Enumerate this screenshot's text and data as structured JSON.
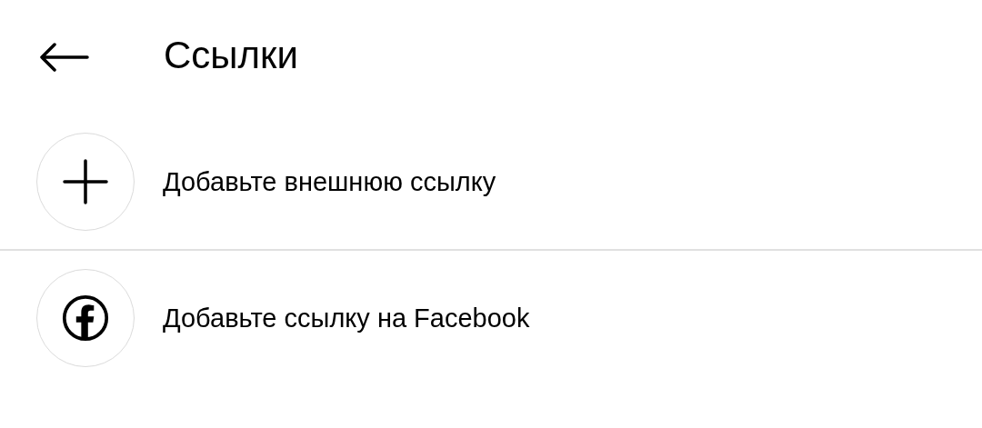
{
  "header": {
    "title": "Ссылки"
  },
  "items": [
    {
      "kind": "add",
      "label": "Добавьте внешнюю ссылку"
    },
    {
      "kind": "facebook",
      "label": "Добавьте ссылку на Facebook"
    }
  ]
}
